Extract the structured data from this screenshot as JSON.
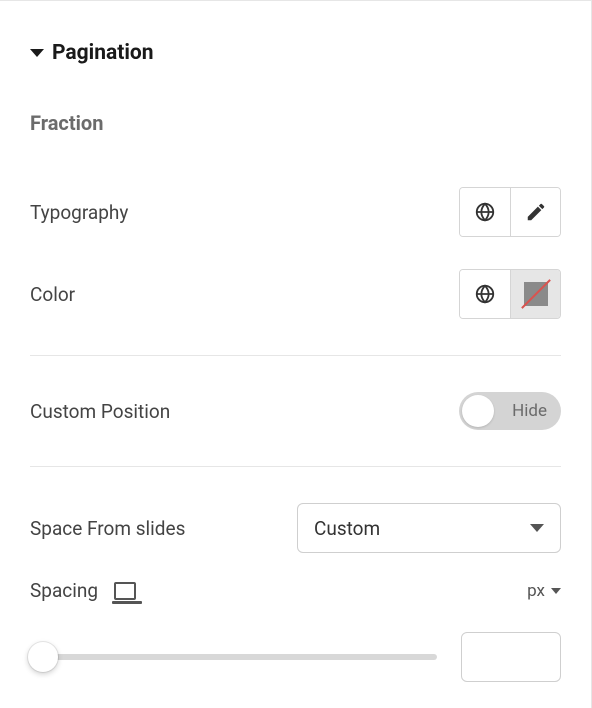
{
  "section": {
    "title": "Pagination"
  },
  "fraction": {
    "heading": "Fraction",
    "typography_label": "Typography",
    "color_label": "Color"
  },
  "custom_position": {
    "label": "Custom Position",
    "toggle_text": "Hide"
  },
  "space_from_slides": {
    "label": "Space From slides",
    "selected": "Custom"
  },
  "spacing": {
    "label": "Spacing",
    "unit": "px",
    "value": ""
  }
}
